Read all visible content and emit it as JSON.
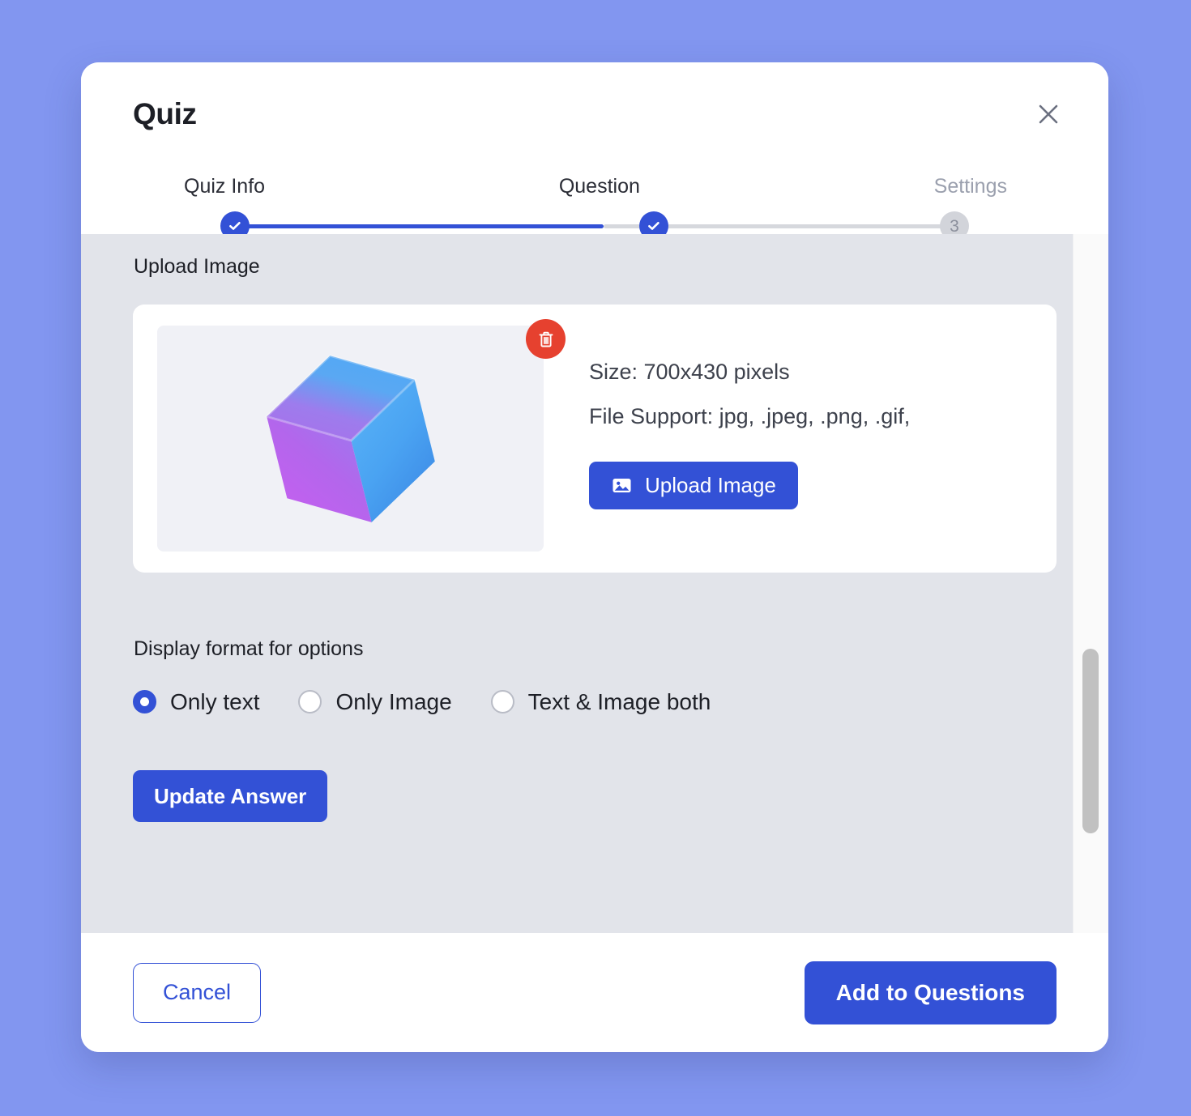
{
  "theme": {
    "page_background": "#8296f0",
    "accent": "#3351d6",
    "panel_background": "#e2e4ea",
    "danger": "#e6412f",
    "muted_text": "#9ba0ae"
  },
  "modal": {
    "title": "Quiz",
    "close_icon": "close-icon"
  },
  "stepper": {
    "steps": [
      {
        "label": "Quiz Info",
        "state": "completed",
        "marker": "check-icon"
      },
      {
        "label": "Question",
        "state": "completed",
        "marker": "check-icon"
      },
      {
        "label": "Settings",
        "state": "upcoming",
        "marker": "3"
      }
    ]
  },
  "upload_section": {
    "label": "Upload Image",
    "delete_icon": "trash-icon",
    "thumbnail_alt": "3d-cube-image",
    "size_text": "Size: 700x430 pixels",
    "file_support_text": "File Support: jpg, .jpeg, .png, .gif,",
    "upload_button": {
      "label": "Upload Image",
      "icon": "image-icon"
    }
  },
  "display_format": {
    "title": "Display format for options",
    "options": [
      {
        "label": "Only text",
        "selected": true
      },
      {
        "label": "Only Image",
        "selected": false
      },
      {
        "label": "Text & Image both",
        "selected": false
      }
    ]
  },
  "update_answer": {
    "label": "Update Answer"
  },
  "footer": {
    "cancel_label": "Cancel",
    "submit_label": "Add to Questions"
  }
}
